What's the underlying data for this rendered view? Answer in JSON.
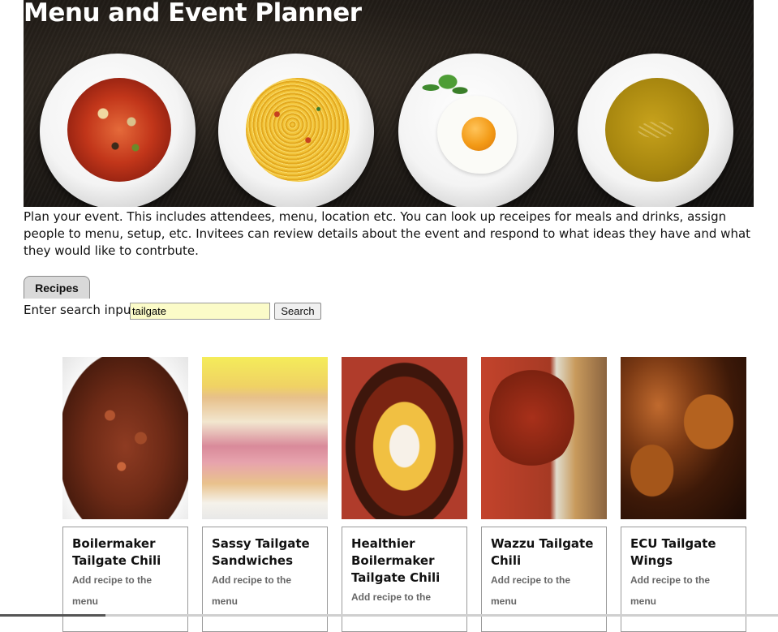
{
  "page": {
    "title": "Menu and Event Planner",
    "intro": "Plan your event. This includes attendees, menu, location etc. You can look up receipes for meals and drinks, assign people to menu, setup, etc. Invitees can review details about the event and respond to what ideas they have and what they would like to contrbute."
  },
  "tabs": [
    {
      "label": "Recipes"
    }
  ],
  "search": {
    "label": "Enter search input",
    "value": "tailgate",
    "button_label": "Search"
  },
  "recipes": [
    {
      "title": "Boilermaker Tailgate Chili",
      "action": "Add recipe to the menu"
    },
    {
      "title": "Sassy Tailgate Sandwiches",
      "action": "Add recipe to the menu"
    },
    {
      "title": "Healthier Boilermaker Tailgate Chili",
      "action": "Add recipe to the"
    },
    {
      "title": "Wazzu Tailgate Chili",
      "action": "Add recipe to the menu"
    },
    {
      "title": "ECU Tailgate Wings",
      "action": "Add recipe to the menu"
    }
  ],
  "colors": {
    "search_input_background": "#fbfbc8",
    "tab_background": "#d9d9d9",
    "hero_background": "#221d18"
  }
}
